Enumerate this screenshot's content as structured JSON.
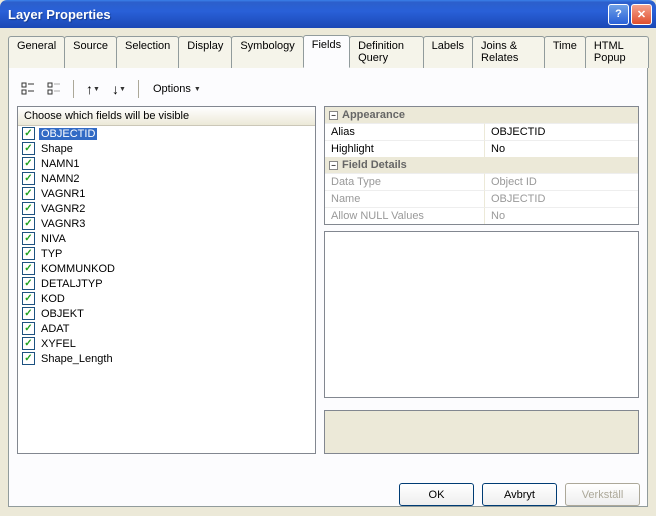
{
  "window": {
    "title": "Layer Properties"
  },
  "tabs": {
    "general": "General",
    "source": "Source",
    "selection": "Selection",
    "display": "Display",
    "symbology": "Symbology",
    "fields": "Fields",
    "defquery": "Definition Query",
    "labels": "Labels",
    "joins": "Joins & Relates",
    "time": "Time",
    "htmlpopup": "HTML Popup"
  },
  "toolbar": {
    "options": "Options"
  },
  "fields_header": "Choose which fields will be visible",
  "fields": [
    {
      "name": "OBJECTID",
      "checked": true,
      "selected": true
    },
    {
      "name": "Shape",
      "checked": true
    },
    {
      "name": "NAMN1",
      "checked": true
    },
    {
      "name": "NAMN2",
      "checked": true
    },
    {
      "name": "VAGNR1",
      "checked": true
    },
    {
      "name": "VAGNR2",
      "checked": true
    },
    {
      "name": "VAGNR3",
      "checked": true
    },
    {
      "name": "NIVA",
      "checked": true
    },
    {
      "name": "TYP",
      "checked": true
    },
    {
      "name": "KOMMUNKOD",
      "checked": true
    },
    {
      "name": "DETALJTYP",
      "checked": true
    },
    {
      "name": "KOD",
      "checked": true
    },
    {
      "name": "OBJEKT",
      "checked": true
    },
    {
      "name": "ADAT",
      "checked": true
    },
    {
      "name": "XYFEL",
      "checked": true
    },
    {
      "name": "Shape_Length",
      "checked": true
    }
  ],
  "props": {
    "appearance_title": "Appearance",
    "alias_label": "Alias",
    "alias_value": "OBJECTID",
    "highlight_label": "Highlight",
    "highlight_value": "No",
    "details_title": "Field Details",
    "datatype_label": "Data Type",
    "datatype_value": "Object ID",
    "name_label": "Name",
    "name_value": "OBJECTID",
    "allownull_label": "Allow NULL Values",
    "allownull_value": "No"
  },
  "buttons": {
    "ok": "OK",
    "cancel": "Avbryt",
    "apply": "Verkställ"
  }
}
